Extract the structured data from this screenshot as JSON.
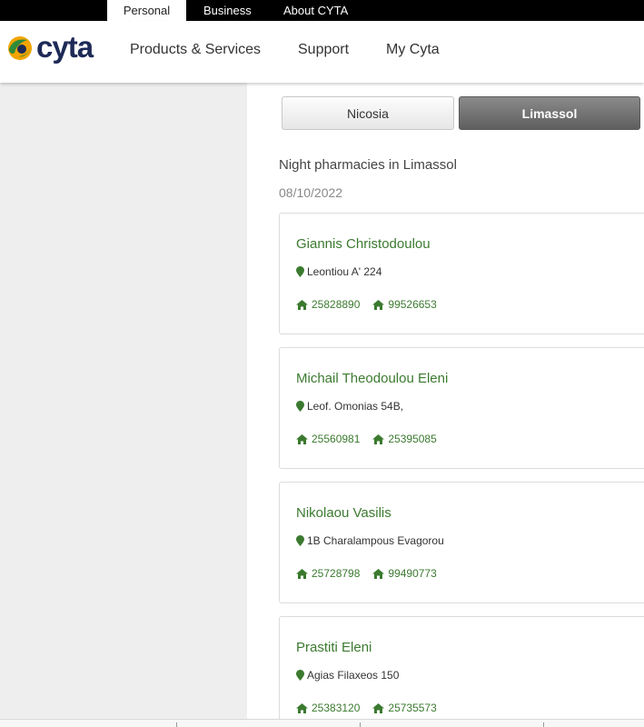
{
  "topbar": {
    "tabs": [
      {
        "label": "Personal",
        "active": true
      },
      {
        "label": "Business",
        "active": false
      },
      {
        "label": "About CYTA",
        "active": false
      }
    ]
  },
  "header": {
    "logo_text": "cyta",
    "nav": [
      "Products & Services",
      "Support",
      "My Cyta"
    ]
  },
  "cities": [
    {
      "label": "Nicosia",
      "active": false
    },
    {
      "label": "Limassol",
      "active": true
    }
  ],
  "section": {
    "title": "Night pharmacies in Limassol",
    "date": "08/10/2022"
  },
  "pharmacies": [
    {
      "name": "Giannis Christodoulou",
      "address": "Leontiou A' 224",
      "phones": [
        "25828890",
        "99526653"
      ]
    },
    {
      "name": "Michail Theodoulou Eleni",
      "address": "Leof. Omonias 54B,",
      "phones": [
        "25560981",
        "25395085"
      ]
    },
    {
      "name": "Nikolaou Vasilis",
      "address": "1B Charalampous Evagorou",
      "phones": [
        "25728798",
        "99490773"
      ]
    },
    {
      "name": "Prastiti Eleni",
      "address": "Agias Filaxeos 150",
      "phones": [
        "25383120",
        "25735573"
      ]
    }
  ],
  "colors": {
    "brand_green": "#3b7a2f",
    "logo_navy": "#1d2a57",
    "topbar": "#000000"
  },
  "icons": {
    "address": "map-pin-icon",
    "phone": "house-icon"
  }
}
